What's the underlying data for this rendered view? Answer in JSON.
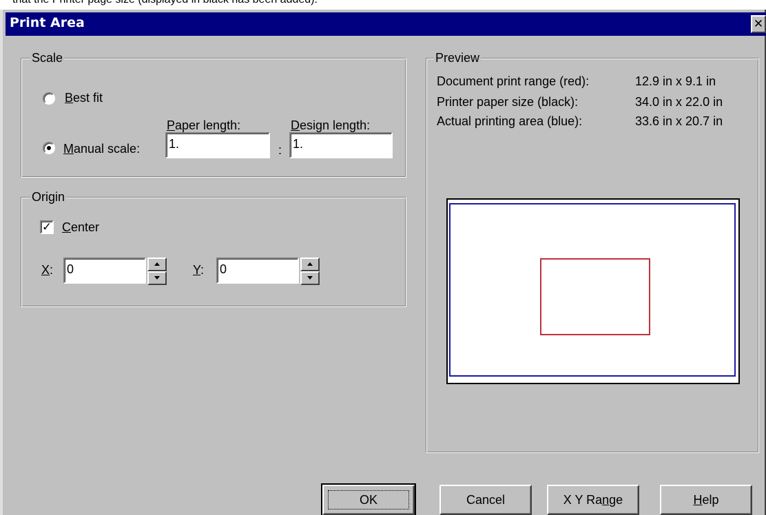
{
  "top_caption": "that the Printer page size (displayed in black has been added).",
  "dialog": {
    "title": "Print Area",
    "close_glyph": "✕"
  },
  "scale": {
    "group_label": "Scale",
    "best_fit": {
      "mnemonic": "B",
      "rest": "est fit",
      "selected": false
    },
    "paper_length": {
      "mnemonic": "P",
      "rest": "aper length:"
    },
    "design_length": {
      "mnemonic": "D",
      "rest": "esign length:"
    },
    "manual_scale": {
      "mnemonic": "M",
      "rest": "anual scale:",
      "selected": true
    },
    "paper_length_value": "1.",
    "separator": ":",
    "design_length_value": "1."
  },
  "origin": {
    "group_label": "Origin",
    "center": {
      "mnemonic": "C",
      "rest": "enter",
      "checked": true,
      "check_glyph": "✓"
    },
    "x": {
      "mnemonic": "X",
      "rest": ":",
      "value": "0"
    },
    "y": {
      "mnemonic": "Y",
      "rest": ":",
      "value": "0"
    }
  },
  "preview": {
    "group_label": "Preview",
    "rows": [
      {
        "label": "Document print range (red):",
        "value": "12.9 in x 9.1 in"
      },
      {
        "label": "Printer paper size (black):",
        "value": "34.0 in x 22.0 in"
      },
      {
        "label": "Actual printing area (blue):",
        "value": "33.6 in x 20.7 in"
      }
    ],
    "colors": {
      "paper": "#000000",
      "printing_area": "#1a1aa8",
      "document_range": "#c0303a"
    }
  },
  "buttons": {
    "ok": "OK",
    "cancel": "Cancel",
    "xy_range": {
      "before": "X Y Ra",
      "mnemonic": "n",
      "after": "ge"
    },
    "help": {
      "mnemonic": "H",
      "rest": "elp"
    }
  }
}
